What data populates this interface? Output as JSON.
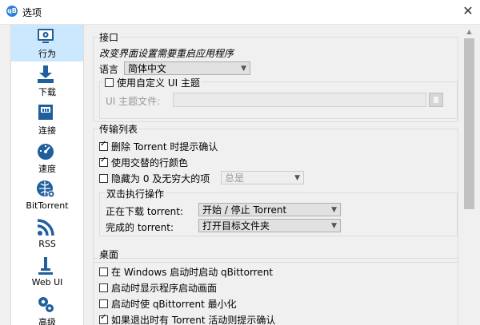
{
  "window": {
    "title": "选项",
    "app_icon_text": "qB",
    "close_symbol": "✕"
  },
  "sidebar": {
    "items": [
      {
        "label": "行为",
        "icon": "behavior-icon"
      },
      {
        "label": "下载",
        "icon": "download-icon"
      },
      {
        "label": "连接",
        "icon": "connection-icon"
      },
      {
        "label": "速度",
        "icon": "speed-icon"
      },
      {
        "label": "BitTorrent",
        "icon": "bittorrent-icon"
      },
      {
        "label": "RSS",
        "icon": "rss-icon"
      },
      {
        "label": "Web UI",
        "icon": "webui-icon"
      },
      {
        "label": "高级",
        "icon": "advanced-icon"
      }
    ],
    "selected_index": 0
  },
  "interface": {
    "title": "接口",
    "restart_note": "改变界面设置需要重启应用程序",
    "language_label": "语言",
    "language_value": "简体中文",
    "custom_theme_label": "使用自定义 UI 主题",
    "theme_file_label": "UI 主题文件:"
  },
  "transfer_list": {
    "title": "传输列表",
    "confirm_delete": "删除 Torrent 时提示确认",
    "alt_row_colors": "使用交替的行颜色",
    "hide_zero_label": "隐藏为 0 及无穷大的项",
    "hide_zero_value": "总是",
    "double_click": {
      "title": "双击执行操作",
      "downloading_label": "正在下载 torrent:",
      "downloading_value": "开始 / 停止 Torrent",
      "completed_label": "完成的 torrent:",
      "completed_value": "打开目标文件夹"
    }
  },
  "desktop": {
    "title": "桌面",
    "start_with_windows": "在 Windows 启动时启动 qBittorrent",
    "show_splash": "启动时显示程序启动画面",
    "start_minimized": "启动时使 qBittorrent 最小化",
    "confirm_exit": "如果退出时有 Torrent 活动则提示确认"
  },
  "colors": {
    "selected_bg": "#cce8ff",
    "icon_blue": "#1f5f9e"
  }
}
